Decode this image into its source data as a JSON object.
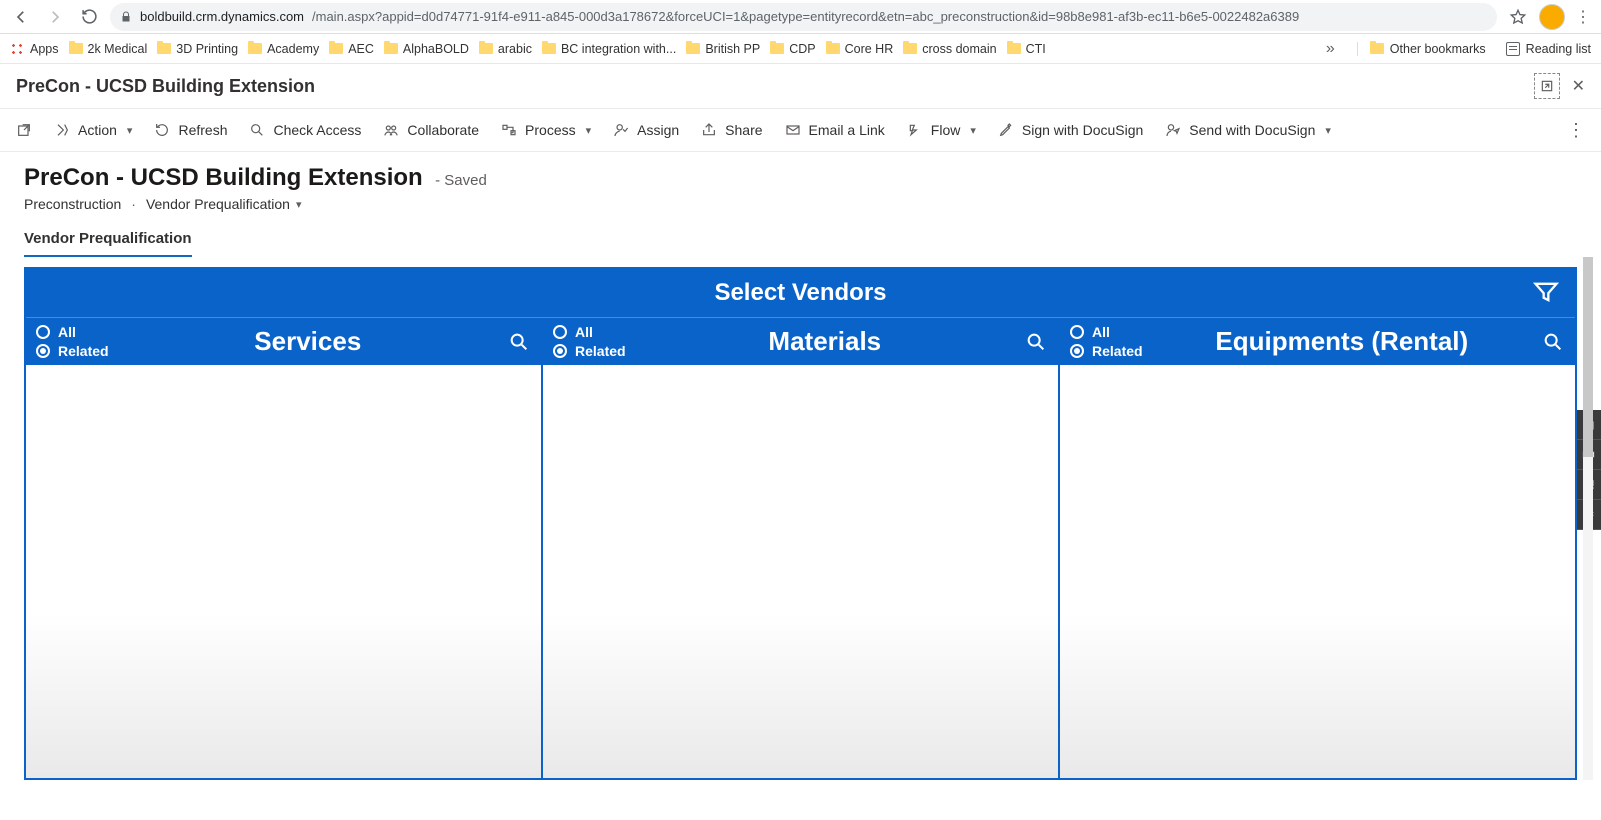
{
  "browser": {
    "url_host": "boldbuild.crm.dynamics.com",
    "url_path": "/main.aspx?appid=d0d74771-91f4-e911-a845-000d3a178672&forceUCI=1&pagetype=entityrecord&etn=abc_preconstruction&id=98b8e981-af3b-ec11-b6e5-0022482a6389",
    "apps_label": "Apps",
    "bookmarks": [
      "2k Medical",
      "3D Printing",
      "Academy",
      "AEC",
      "AlphaBOLD",
      "arabic",
      "BC integration with...",
      "British PP",
      "CDP",
      "Core HR",
      "cross domain",
      "CTI"
    ],
    "other_bookmarks": "Other bookmarks",
    "reading_list": "Reading list"
  },
  "titlebar": {
    "record_name": "PreCon - UCSD Building Extension"
  },
  "commands": {
    "action": "Action",
    "refresh": "Refresh",
    "check_access": "Check Access",
    "collaborate": "Collaborate",
    "process": "Process",
    "assign": "Assign",
    "share": "Share",
    "email_link": "Email a Link",
    "flow": "Flow",
    "sign_docusign": "Sign with DocuSign",
    "send_docusign": "Send with DocuSign"
  },
  "heading": {
    "title": "PreCon - UCSD Building Extension",
    "saved": "- Saved",
    "entity": "Preconstruction",
    "view": "Vendor Prequalification"
  },
  "tabs": {
    "vendor_prequal": "Vendor Prequalification"
  },
  "vendors": {
    "title": "Select Vendors",
    "all_label": "All",
    "related_label": "Related",
    "columns": {
      "services": "Services",
      "materials": "Materials",
      "equipments": "Equipments (Rental)"
    }
  }
}
